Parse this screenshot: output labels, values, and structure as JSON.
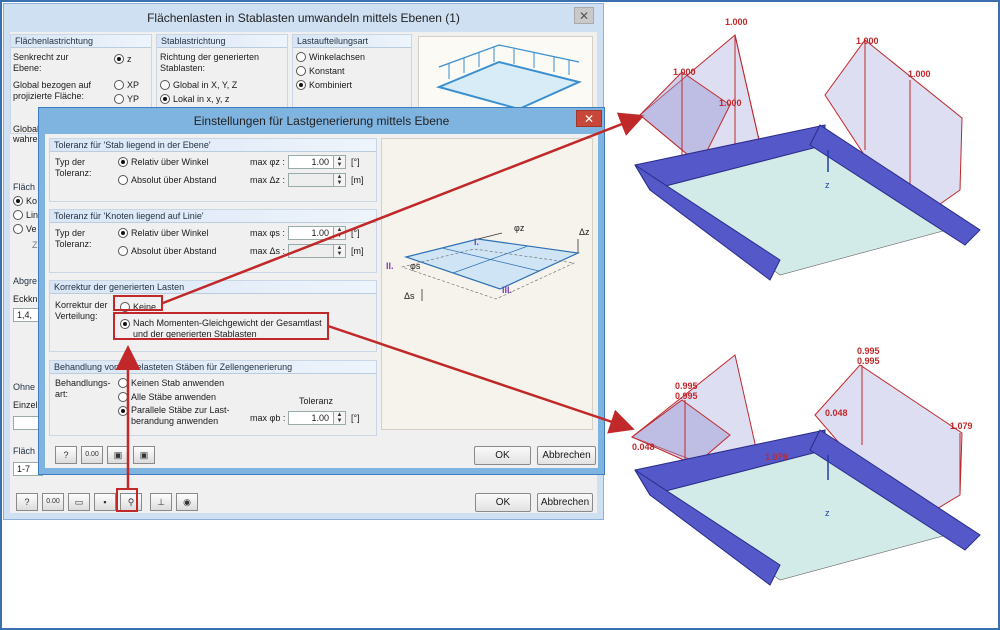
{
  "back_dialog": {
    "title": "Flächenlasten in Stablasten umwandeln mittels Ebenen   (1)",
    "flaechenlastrichtung": {
      "header": "Flächenlastrichtung",
      "senkrecht_label": "Senkrecht zur Ebene:",
      "z_option": "z",
      "global_label": "Global bezogen auf projizierte Fläche:",
      "xp_option": "XP",
      "yp_option": "YP",
      "global_partial": "Global",
      "wahre_partial": "wahre"
    },
    "stablastrichtung": {
      "header": "Stablastrichtung",
      "desc": "Richtung der generierten Stablasten:",
      "opt_global": "Global in X, Y, Z",
      "opt_lokal": "Lokal in x, y, z"
    },
    "lastaufteilungsart": {
      "header": "Lastaufteilungsart",
      "opt_winkel": "Winkelachsen",
      "opt_konstant": "Konstant",
      "opt_kombiniert": "Kombiniert"
    },
    "left_partials": {
      "flaech1": "Fläch",
      "ko": "Ko",
      "lin": "Lin",
      "ve": "Ve",
      "z": "Z",
      "abgre": "Abgre",
      "eckkn": "Eckkn",
      "eck_value": "1,4,",
      "ohne": "Ohne",
      "einzel": "Einzel",
      "flaech2": "Fläch",
      "flaech2_value": "1-7"
    },
    "ok_label": "OK",
    "cancel_label": "Abbrechen"
  },
  "front_dialog": {
    "title": "Einstellungen für Lastgenerierung mittels Ebene",
    "tol_stab": {
      "header": "Toleranz für 'Stab liegend in der Ebene'",
      "typ_label": "Typ der Toleranz:",
      "opt_rel": "Relativ über Winkel",
      "opt_abs": "Absolut über Abstand",
      "max_phi": "max φz :",
      "phi_value": "1.00",
      "phi_unit": "[°]",
      "max_delta": "max Δz :",
      "delta_value": "",
      "delta_unit": "[m]"
    },
    "tol_knoten": {
      "header": "Toleranz für 'Knoten liegend auf Linie'",
      "typ_label": "Typ der Toleranz:",
      "opt_rel": "Relativ über Winkel",
      "opt_abs": "Absolut über Abstand",
      "max_phi": "max φs :",
      "phi_value": "1.00",
      "phi_unit": "[°]",
      "max_delta": "max Δs :",
      "delta_value": "",
      "delta_unit": "[m]"
    },
    "korrektur": {
      "header": "Korrektur der generierten Lasten",
      "label": "Korrektur der Verteilung:",
      "opt_keine": "Keine",
      "opt_moment": "Nach Momenten-Gleichgewicht der Gesamtlast und der generierten Stablasten"
    },
    "behandlung": {
      "header": "Behandlung von unbelasteten Stäben für Zellengenerierung",
      "label": "Behandlungs-art:",
      "opt_keinen": "Keinen Stab anwenden",
      "opt_alle": "Alle Stäbe anwenden",
      "opt_parallel": "Parallele Stäbe zur Last-berandung anwenden",
      "toleranz": "Toleranz",
      "max_phi": "max φb :",
      "phi_value": "1.00",
      "phi_unit": "[°]"
    },
    "illus_labels": {
      "i": "I.",
      "ii": "II.",
      "iii": "III.",
      "phi_z": "φz",
      "delta_z": "Δz",
      "phi_s": "φs",
      "delta_s": "Δs"
    },
    "ok_label": "OK",
    "cancel_label": "Abbrechen"
  },
  "diagram_top": {
    "labels": [
      "1.000",
      "1.000",
      "1.000",
      "1.000",
      "1.000"
    ],
    "axis": "z"
  },
  "diagram_bottom": {
    "labels": [
      "0.995",
      "0.995",
      "0.995",
      "0.995",
      "0.048",
      "0.048",
      "1.079",
      "1.079"
    ],
    "axis": "z"
  },
  "colors": {
    "accent_red": "#c0282a",
    "title_blue": "#7fb3e0",
    "beam_blue": "#4c4fc0"
  }
}
